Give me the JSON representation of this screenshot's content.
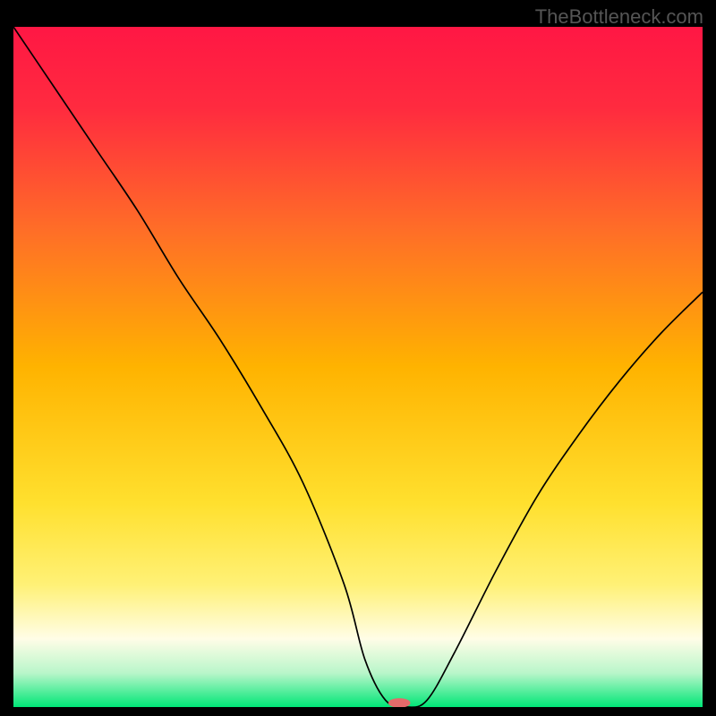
{
  "watermark": "TheBottleneck.com",
  "chart_data": {
    "type": "line",
    "title": "",
    "xlabel": "",
    "ylabel": "",
    "xlim": [
      0,
      100
    ],
    "ylim": [
      0,
      100
    ],
    "background_gradient": [
      {
        "pos": 0.0,
        "color": "#ff1744"
      },
      {
        "pos": 0.12,
        "color": "#ff2b3f"
      },
      {
        "pos": 0.3,
        "color": "#ff6e27"
      },
      {
        "pos": 0.5,
        "color": "#ffb300"
      },
      {
        "pos": 0.7,
        "color": "#ffe02e"
      },
      {
        "pos": 0.82,
        "color": "#fff176"
      },
      {
        "pos": 0.9,
        "color": "#fffde7"
      },
      {
        "pos": 0.95,
        "color": "#b9f6ca"
      },
      {
        "pos": 1.0,
        "color": "#00e676"
      }
    ],
    "series": [
      {
        "name": "bottleneck-curve",
        "x": [
          0,
          6,
          12,
          18,
          24,
          30,
          36,
          42,
          48,
          51,
          54,
          57,
          60,
          64,
          70,
          76,
          82,
          88,
          94,
          100
        ],
        "y": [
          100,
          91,
          82,
          73,
          63,
          54,
          44,
          33,
          18,
          7,
          1,
          0,
          1,
          8,
          20,
          31,
          40,
          48,
          55,
          61
        ]
      }
    ],
    "marker": {
      "x": 56,
      "y": 0.6,
      "color": "#e46a6a",
      "rx": 1.6,
      "ry": 0.7
    }
  }
}
